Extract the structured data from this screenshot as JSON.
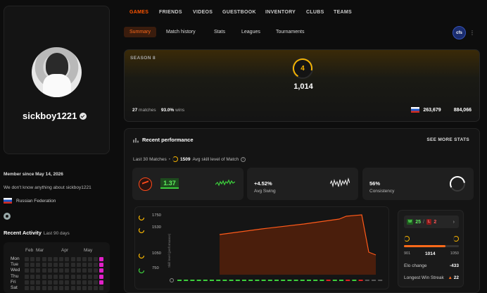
{
  "profile": {
    "username": "sickboy1221",
    "member_since": "Member since May 14, 2026",
    "bio": "We don't know anything about sickboy1221",
    "country": "Russian Federation"
  },
  "activity": {
    "title": "Recent Activity",
    "subtitle": "Last 90 days",
    "months": [
      "Feb",
      "Mar",
      "Apr",
      "May"
    ],
    "days": [
      "Mon",
      "Tue",
      "Wed",
      "Thu",
      "Fri",
      "Sat"
    ],
    "accent_color": "#e11fc8"
  },
  "nav": {
    "top": [
      "GAMES",
      "FRIENDS",
      "VIDEOS",
      "GUESTBOOK",
      "INVENTORY",
      "CLUBS",
      "TEAMS"
    ],
    "active_top": "GAMES",
    "sub": [
      "Summary",
      "Match history",
      "Stats",
      "Leagues",
      "Tournaments"
    ],
    "active_sub": "Summary",
    "badge": "cfs"
  },
  "season": {
    "label": "SEASON 8",
    "level": "4",
    "elo": "1,014",
    "matches_value": "27",
    "matches_label": "matches",
    "winrate_value": "93.0%",
    "winrate_label": "wins",
    "rank_country": "263,679",
    "rank_global": "884,066"
  },
  "performance": {
    "title": "Recent performance",
    "see_more": "SEE MORE STATS",
    "last_matches_label": "Last 30 Matches",
    "skill_value": "1509",
    "skill_label": "Avg skill level of Match",
    "kd_value": "1.37",
    "swing_value": "+4.52%",
    "swing_label": "Avg Swing",
    "consistency_value": "56%",
    "consistency_label": "Consistency",
    "chart_y_labels": [
      "1750",
      "1530",
      "1050",
      "750"
    ],
    "chart_vertical_label": "Skill level (performance)",
    "side": {
      "wins": "25",
      "losses": "2",
      "w_label": "W",
      "l_label": "L",
      "separator": "/",
      "next_icon": "chevron-right-icon",
      "elo_min": "901",
      "elo_current": "1014",
      "elo_max": "1050",
      "elo_change_label": "Elo change",
      "elo_change_value": "-433",
      "streak_label": "Longest Win Streak",
      "streak_value": "22"
    }
  },
  "colors": {
    "accent": "#ff5500",
    "win": "#3ccf3c",
    "loss": "#e02020",
    "level": "#f5b300"
  }
}
